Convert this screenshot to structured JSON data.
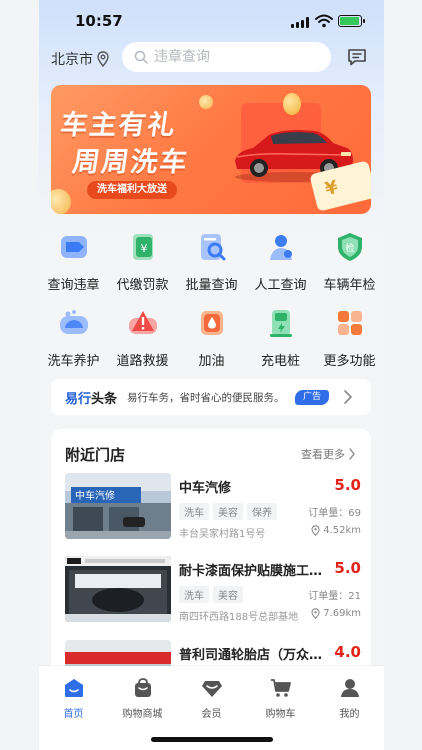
{
  "status_bar": {
    "time": "10:57"
  },
  "header": {
    "city": "北京市",
    "search_placeholder": "违章查询",
    "icons": {
      "location": "location-pin-icon",
      "message": "message-icon"
    }
  },
  "banner": {
    "line1": "车主有礼",
    "line2": "周周洗车",
    "tag": "洗车福利大放送",
    "coupon": "¥"
  },
  "functions": [
    {
      "label": "查询违章",
      "icon": "violation-query-icon",
      "color": "#3b7cf6"
    },
    {
      "label": "代缴罚款",
      "icon": "pay-fine-icon",
      "color": "#2fb36b"
    },
    {
      "label": "批量查询",
      "icon": "batch-query-icon",
      "color": "#4a83f5"
    },
    {
      "label": "人工查询",
      "icon": "manual-query-icon",
      "color": "#3d7cf2"
    },
    {
      "label": "车辆年检",
      "icon": "annual-inspection-icon",
      "color": "#2fb36b"
    },
    {
      "label": "洗车养护",
      "icon": "car-wash-icon",
      "color": "#4c86f7"
    },
    {
      "label": "道路救援",
      "icon": "road-rescue-icon",
      "color": "#ef4a46"
    },
    {
      "label": "加油",
      "icon": "fuel-icon",
      "color": "#f46a3a"
    },
    {
      "label": "充电桩",
      "icon": "charging-pile-icon",
      "color": "#2fb36b"
    },
    {
      "label": "更多功能",
      "icon": "more-functions-icon",
      "color": "#f37a3a"
    }
  ],
  "news": {
    "brand_a": "易行",
    "brand_b": "头条",
    "text": "易行车务，省时省心的便民服务。",
    "ad_label": "广告"
  },
  "nearby": {
    "title": "附近门店",
    "more_label": "查看更多",
    "stores": [
      {
        "name": "中车汽修",
        "score": "5.0",
        "tags": [
          "洗车",
          "美容",
          "保养"
        ],
        "orders": "订单量：69",
        "address": "丰台吴家村路1号号",
        "distance": "4.52km",
        "sign": "中车汽修"
      },
      {
        "name": "耐卡漆面保护贴膜施工中心",
        "score": "5.0",
        "tags": [
          "洗车",
          "美容"
        ],
        "orders": "订单量：21",
        "address": "南四环西路188号总部基地",
        "distance": "7.69km",
        "sign": ""
      },
      {
        "name": "普利司通轮胎店（万众瑞驰）",
        "score": "4.0",
        "tags": [],
        "orders": "",
        "address": "",
        "distance": "",
        "sign": ""
      }
    ]
  },
  "tabbar": [
    {
      "label": "首页",
      "icon": "home-icon",
      "active": true
    },
    {
      "label": "购物商城",
      "icon": "shopping-mall-icon",
      "active": false
    },
    {
      "label": "会员",
      "icon": "membership-icon",
      "active": false
    },
    {
      "label": "购物车",
      "icon": "cart-icon",
      "active": false
    },
    {
      "label": "我的",
      "icon": "profile-icon",
      "active": false
    }
  ],
  "colors": {
    "accent": "#2f6ee8",
    "score": "#e0241b",
    "banner": "#ff7a45"
  }
}
